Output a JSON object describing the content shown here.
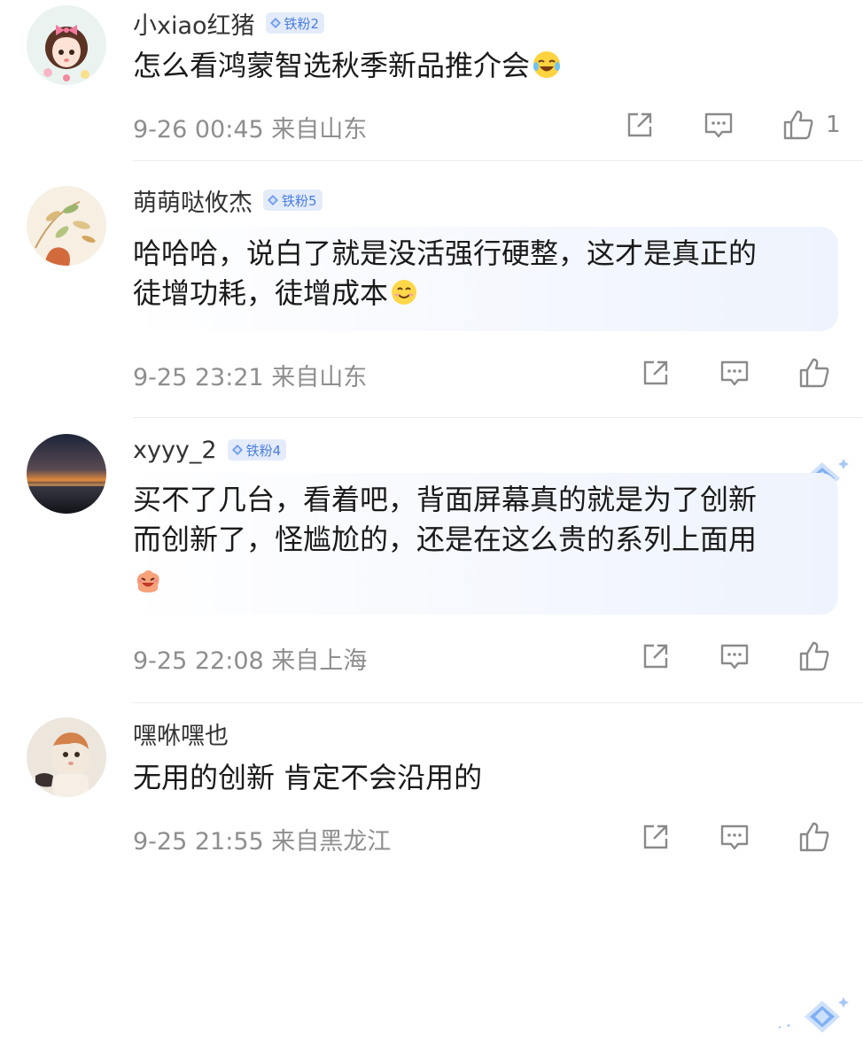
{
  "comments": [
    {
      "username": "小xiao红猪",
      "badge": "铁粉2",
      "text_lines": [
        "怎么看鸿蒙智选秋季新品推介会"
      ],
      "emoji": "laugh-cry-emoji",
      "time_location": "9-26 00:45  来自山东",
      "like_count": "1",
      "highlighted": false
    },
    {
      "username": "萌萌哒攸杰",
      "badge": "铁粉5",
      "text_lines": [
        "哈哈哈，说白了就是没活强行硬整，这才是真正的",
        "徒增功耗，徒增成本"
      ],
      "emoji": "smile-emoji",
      "time_location": "9-25 23:21  来自山东",
      "like_count": "",
      "highlighted": true
    },
    {
      "username": "xyyy_2",
      "badge": "铁粉4",
      "text_lines": [
        "买不了几台，看着吧，背面屏幕真的就是为了创新",
        "而创新了，怪尴尬的，还是在这么贵的系列上面用"
      ],
      "emoji": "laughing-blob-emoji",
      "time_location": "9-25 22:08  来自上海",
      "like_count": "",
      "highlighted": true
    },
    {
      "username": "嘿咻嘿也",
      "badge": "",
      "text_lines": [
        "无用的创新 肯定不会沿用的"
      ],
      "emoji": "",
      "time_location": "9-25 21:55  来自黑龙江",
      "like_count": "",
      "highlighted": false
    }
  ],
  "icons": {
    "share": "share-icon",
    "reply": "comment-icon",
    "like": "thumbs-up-icon",
    "badge": "diamond-icon"
  },
  "colors": {
    "badge_bg": "#e4ecfb",
    "badge_text": "#4a7de0",
    "meta_text": "#8e8e8e"
  }
}
